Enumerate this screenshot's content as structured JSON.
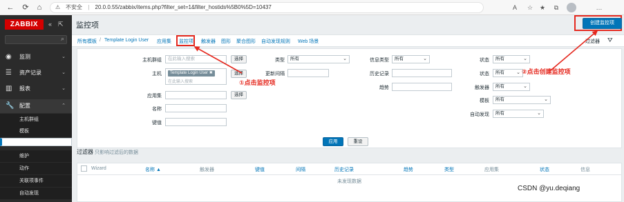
{
  "browser": {
    "security_label": "不安全",
    "url": "20.0.0.55/zabbix/items.php?filter_set=1&filter_hostids%5B0%5D=10437"
  },
  "sidebar": {
    "logo": "ZABBIX",
    "items": [
      {
        "label": "监测",
        "icon": "eye-icon"
      },
      {
        "label": "资产记录",
        "icon": "list-icon"
      },
      {
        "label": "报表",
        "icon": "chart-icon"
      },
      {
        "label": "配置",
        "icon": "wrench-icon"
      }
    ],
    "config_sub": [
      "主机群组",
      "模板",
      "主机",
      "维护",
      "动作",
      "关联项事件",
      "自动发现"
    ]
  },
  "header": {
    "title": "监控项",
    "create_button": "创建监控项"
  },
  "breadcrumbs": {
    "all_templates": "所有模板",
    "template": "Template Login User",
    "tabs": [
      "应用集",
      "监控项",
      "触发器",
      "图形",
      "聚合图形",
      "自动发现规则",
      "Web 场景"
    ]
  },
  "filter_tab": "过滤器",
  "filter": {
    "host_group_label": "主机群组",
    "host_group_placeholder": "在此输入搜索",
    "select_button": "选择",
    "host_label": "主机",
    "host_tag": "Template Login User",
    "host_placeholder": "在此输入搜索",
    "app_label": "应用集",
    "name_label": "名称",
    "key_label": "键值",
    "type_label": "类型",
    "type_value": "所有",
    "interval_label": "更新间隔",
    "history_label": "历史记录",
    "trends_label": "趋势",
    "info_type_label": "信息类型",
    "info_type_value": "所有",
    "status_label": "状态",
    "status_value": "所有",
    "status2_label": "状态",
    "status2_value": "所有",
    "trigger_label": "触发器",
    "trigger_value": "所有",
    "template_label": "模板",
    "template_value": "所有",
    "discovery_label": "自动发现",
    "discovery_value": "所有",
    "apply_button": "应用",
    "reset_button": "重设"
  },
  "subfilter": {
    "title": "过滤器",
    "hint": "只影响过滤后的数据"
  },
  "table": {
    "columns": [
      "Wizard",
      "名称 ▲",
      "触发器",
      "键值",
      "间隔",
      "历史记录",
      "趋势",
      "类型",
      "应用集",
      "状态",
      "信息"
    ],
    "empty_text": "未发现数据"
  },
  "annotations": {
    "step1": "①点击监控项",
    "step2": "②点击创建监控项"
  },
  "watermark": "CSDN @yu.deqiang",
  "colors": {
    "accent": "#0275b8",
    "annotation": "#e5281e",
    "sidebar_bg": "#2b2b2b",
    "logo_bg": "#d40000"
  }
}
